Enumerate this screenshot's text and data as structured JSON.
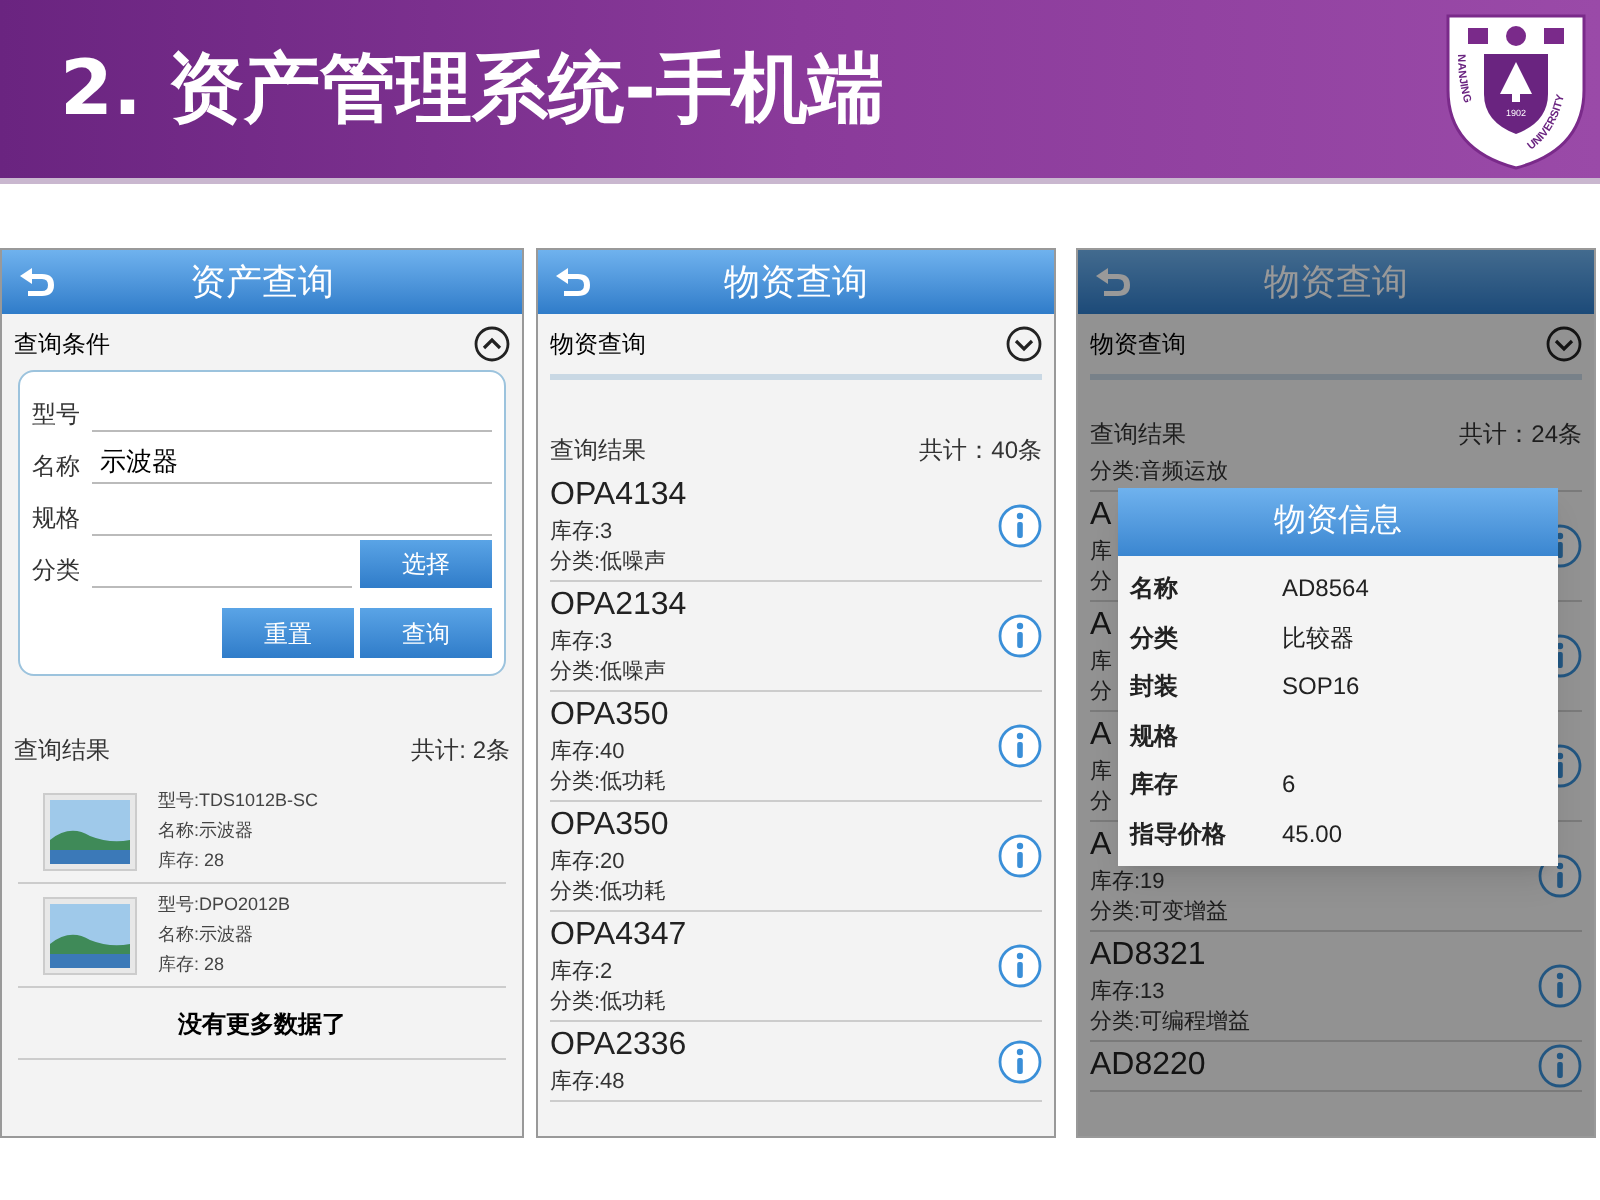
{
  "slide": {
    "title": "2. 资产管理系统-手机端",
    "logo": {
      "name": "NANJING UNIVERSITY",
      "year": "1902"
    }
  },
  "screens": [
    {
      "kind": "asset_search",
      "dimmed": false,
      "header": {
        "title": "资产查询"
      },
      "criteria": {
        "label": "查询条件",
        "expanded": true,
        "fields": [
          {
            "label": "型号"
          },
          {
            "label": "名称",
            "value": "示波器"
          },
          {
            "label": "规格"
          },
          {
            "label": "分类",
            "button": "选择"
          }
        ],
        "buttons": [
          "重置",
          "查询"
        ]
      },
      "results": {
        "label": "查询结果",
        "count": "共计: 2条",
        "items": [
          {
            "model": "型号:TDS1012B-SC",
            "name": "名称:示波器",
            "stock": "库存: 28"
          },
          {
            "model": "型号:DPO2012B",
            "name": "名称:示波器",
            "stock": "库存: 28"
          }
        ],
        "footer": "没有更多数据了"
      }
    },
    {
      "kind": "material_search",
      "dimmed": false,
      "header": {
        "title": "物资查询"
      },
      "filter": {
        "label": "物资查询",
        "expanded": false
      },
      "results": {
        "label": "查询结果",
        "count": "共计：40条",
        "items": [
          {
            "name": "OPA4134",
            "stock": "库存:3",
            "category": "分类:低噪声"
          },
          {
            "name": "OPA2134",
            "stock": "库存:3",
            "category": "分类:低噪声"
          },
          {
            "name": "OPA350",
            "stock": "库存:40",
            "category": "分类:低功耗"
          },
          {
            "name": "OPA350",
            "stock": "库存:20",
            "category": "分类:低功耗"
          },
          {
            "name": "OPA4347",
            "stock": "库存:2",
            "category": "分类:低功耗"
          },
          {
            "name": "OPA2336",
            "stock": "库存:48"
          }
        ]
      }
    },
    {
      "kind": "material_search",
      "dimmed": true,
      "header": {
        "title": "物资查询"
      },
      "filter": {
        "label": "物资查询",
        "expanded": false
      },
      "results": {
        "label": "查询结果",
        "count": "共计：24条",
        "items": [
          {
            "category": "分类:音频运放"
          },
          {
            "name": "A",
            "stock": "库",
            "category": "分"
          },
          {
            "name": "A",
            "stock": "库",
            "category": "分"
          },
          {
            "name": "A",
            "stock": "库",
            "category": "分"
          },
          {
            "name": "A",
            "stock": "库存:19",
            "category": "分类:可变增益"
          },
          {
            "name": "AD8321",
            "stock": "库存:13",
            "category": "分类:可编程增益"
          },
          {
            "name": "AD8220"
          }
        ]
      },
      "dialog": {
        "title": "物资信息",
        "rows": [
          {
            "label": "名称",
            "value": "AD8564"
          },
          {
            "label": "分类",
            "value": "比较器"
          },
          {
            "label": "封装",
            "value": "SOP16"
          },
          {
            "label": "规格"
          },
          {
            "label": "库存",
            "value": "6"
          },
          {
            "label": "指导价格",
            "value": "45.00"
          }
        ]
      }
    }
  ]
}
